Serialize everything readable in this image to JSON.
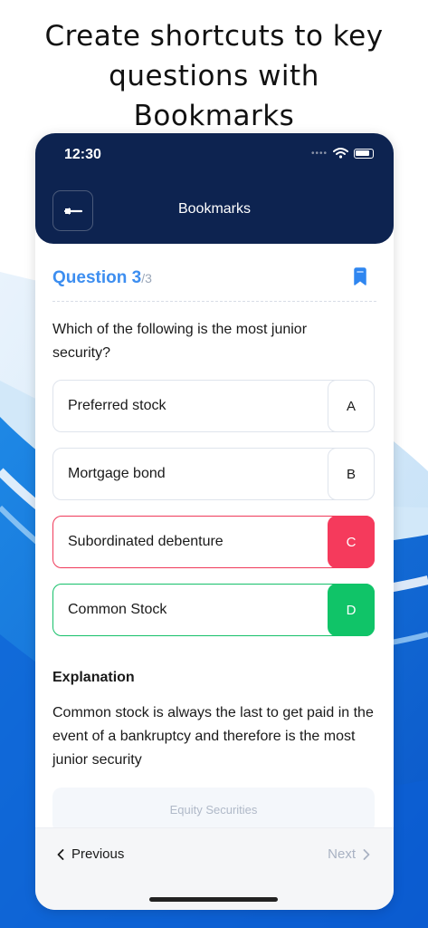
{
  "promo": {
    "line1": "Create shortcuts to key",
    "line2": "questions with",
    "line3": "Bookmarks"
  },
  "status_bar": {
    "time": "12:30",
    "signal_icon": "signal-dots-icon",
    "wifi_icon": "wifi-icon",
    "battery_icon": "battery-icon"
  },
  "header": {
    "title": "Bookmarks",
    "back_icon": "back-arrow-icon"
  },
  "question": {
    "label": "Question 3",
    "total": "/3",
    "text": "Which of the following is the most junior security?",
    "bookmark_icon": "bookmark-icon"
  },
  "options": [
    {
      "text": "Preferred stock",
      "letter": "A",
      "state": "neutral"
    },
    {
      "text": "Mortgage bond",
      "letter": "B",
      "state": "neutral"
    },
    {
      "text": "Subordinated debenture",
      "letter": "C",
      "state": "wrong"
    },
    {
      "text": "Common Stock",
      "letter": "D",
      "state": "correct"
    }
  ],
  "explanation": {
    "title": "Explanation",
    "text": "Common stock is always the last to get paid in the event of a bankruptcy and therefore is the most junior security"
  },
  "topic": "Equity Securities",
  "footer": {
    "prev_label": "Previous",
    "next_label": "Next"
  },
  "colors": {
    "navbar": "#0d2350",
    "accent_blue": "#3d8ef0",
    "wrong": "#f53a5c",
    "correct": "#10c468"
  }
}
